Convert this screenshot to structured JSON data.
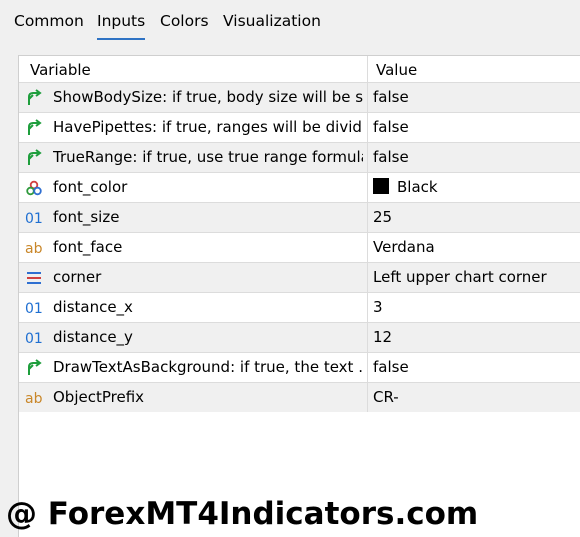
{
  "tabs": [
    {
      "label": "Common"
    },
    {
      "label": "Inputs",
      "active": true
    },
    {
      "label": "Colors"
    },
    {
      "label": "Visualization"
    }
  ],
  "table": {
    "headers": {
      "variable": "Variable",
      "value": "Value"
    },
    "rows": [
      {
        "icon": "bool-arrow-icon",
        "name": "ShowBodySize: if true, body size will be s...",
        "value": "false"
      },
      {
        "icon": "bool-arrow-icon",
        "name": "HavePipettes: if true, ranges will be divid...",
        "value": "false"
      },
      {
        "icon": "bool-arrow-icon",
        "name": "TrueRange: if true, use true range formula.",
        "value": "false"
      },
      {
        "icon": "color-palette-icon",
        "name": "font_color",
        "value": "Black",
        "swatch": "#000000"
      },
      {
        "icon": "integer-icon",
        "name": "font_size",
        "value": "25"
      },
      {
        "icon": "string-icon",
        "name": "font_face",
        "value": "Verdana"
      },
      {
        "icon": "enum-list-icon",
        "name": "corner",
        "value": "Left upper chart corner"
      },
      {
        "icon": "integer-icon",
        "name": "distance_x",
        "value": "3"
      },
      {
        "icon": "integer-icon",
        "name": "distance_y",
        "value": "12"
      },
      {
        "icon": "bool-arrow-icon",
        "name": "DrawTextAsBackground: if true, the text ...",
        "value": "false"
      },
      {
        "icon": "string-icon",
        "name": "ObjectPrefix",
        "value": "CR-"
      }
    ]
  },
  "watermark": "@ ForexMT4Indicators.com",
  "colors": {
    "accent": "#2f73c4",
    "bool_icon": "#1e9e3c",
    "int_icon": "#1f6fd1",
    "string_icon": "#c9872a"
  }
}
